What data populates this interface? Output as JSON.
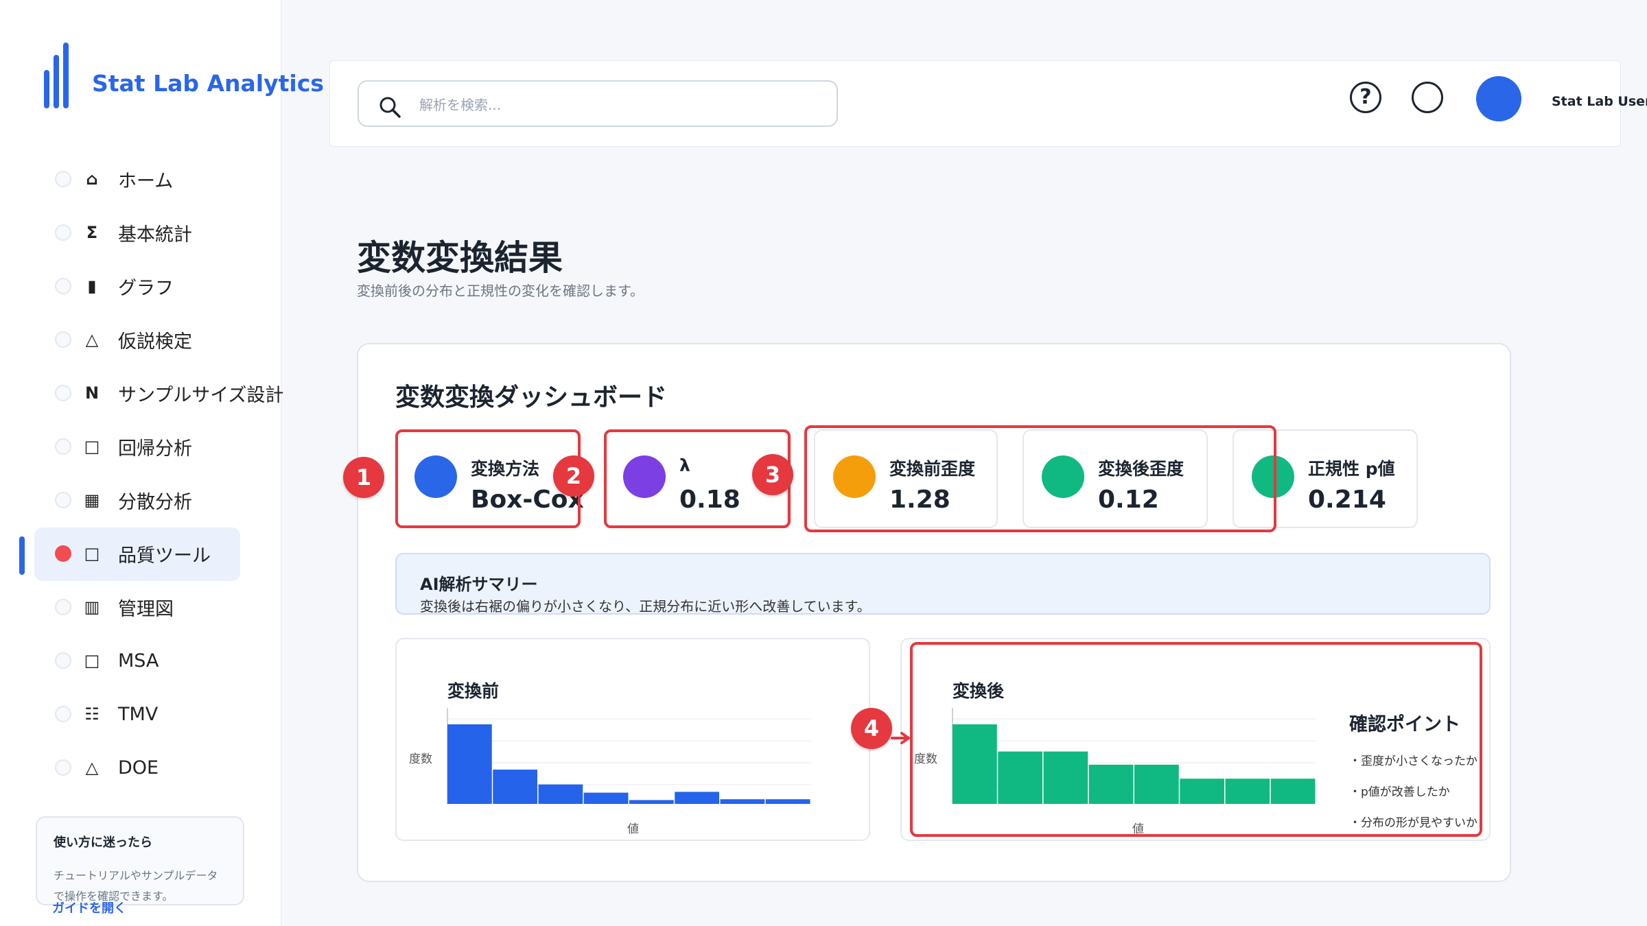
{
  "brand": {
    "name": "Stat Lab Analytics",
    "color": "#2a66e8"
  },
  "sidebar": {
    "items": [
      {
        "icon": "home-icon",
        "glyph": "⌂",
        "label": "ホーム"
      },
      {
        "icon": "sigma-icon",
        "glyph": "Σ",
        "label": "基本統計"
      },
      {
        "icon": "bar-chart-icon",
        "glyph": "▮",
        "label": "グラフ"
      },
      {
        "icon": "triangle-icon",
        "glyph": "△",
        "label": "仮説検定"
      },
      {
        "icon": "n-icon",
        "glyph": "N",
        "label": "サンプルサイズ設計"
      },
      {
        "icon": "square-icon",
        "glyph": "□",
        "label": "回帰分析"
      },
      {
        "icon": "grid-icon",
        "glyph": "▦",
        "label": "分散分析"
      },
      {
        "icon": "square-icon",
        "glyph": "□",
        "label": "品質ツール",
        "active": true
      },
      {
        "icon": "columns-icon",
        "glyph": "▥",
        "label": "管理図"
      },
      {
        "icon": "square-icon",
        "glyph": "□",
        "label": "MSA"
      },
      {
        "icon": "list-icon",
        "glyph": "☷",
        "label": "TMV"
      },
      {
        "icon": "triangle-icon",
        "glyph": "△",
        "label": "DOE"
      }
    ],
    "help": {
      "title": "使い方に迷ったら",
      "text": "チュートリアルやサンプルデータで操作を確認できます。",
      "link": "ガイドを開く"
    }
  },
  "header": {
    "search_placeholder": "解析を検索...",
    "help_glyph": "?",
    "user_name": "Stat Lab User",
    "avatar_color": "#2a66e8"
  },
  "page": {
    "title": "変数変換結果",
    "subtitle": "変換前後の分布と正規性の変化を確認します。"
  },
  "dashboard": {
    "title": "変数変換ダッシュボード",
    "kpis": [
      {
        "label": "変換方法",
        "value": "Box-Cox",
        "color": "#2a66e8"
      },
      {
        "label": "λ",
        "value": "0.18",
        "color": "#7b3fe4"
      },
      {
        "label": "変換前歪度",
        "value": "1.28",
        "color": "#f59e0b"
      },
      {
        "label": "変換後歪度",
        "value": "0.12",
        "color": "#10b981"
      },
      {
        "label": "正規性 p値",
        "value": "0.214",
        "color": "#10b981"
      }
    ],
    "ai_summary": {
      "title": "AI解析サマリー",
      "text": "変換後は右裾の偏りが小さくなり、正規分布に近い形へ改善しています。"
    },
    "check_points": {
      "title": "確認ポイント",
      "items": [
        "・歪度が小さくなったか",
        "・p値が改善したか",
        "・分布の形が見やすいか"
      ]
    }
  },
  "chart_data": [
    {
      "type": "bar",
      "title": "変換前",
      "xlabel": "値",
      "ylabel": "度数",
      "values": [
        10,
        4.5,
        2.7,
        1.7,
        0.8,
        1.8,
        0.9,
        0.9
      ],
      "color": "#2563eb"
    },
    {
      "type": "bar",
      "title": "変換後",
      "xlabel": "値",
      "ylabel": "度数",
      "values": [
        10,
        6.7,
        6.7,
        5.1,
        5.1,
        3.4,
        3.4,
        3.4
      ],
      "color": "#10b981"
    }
  ],
  "annotations": [
    "1",
    "2",
    "3",
    "4"
  ]
}
